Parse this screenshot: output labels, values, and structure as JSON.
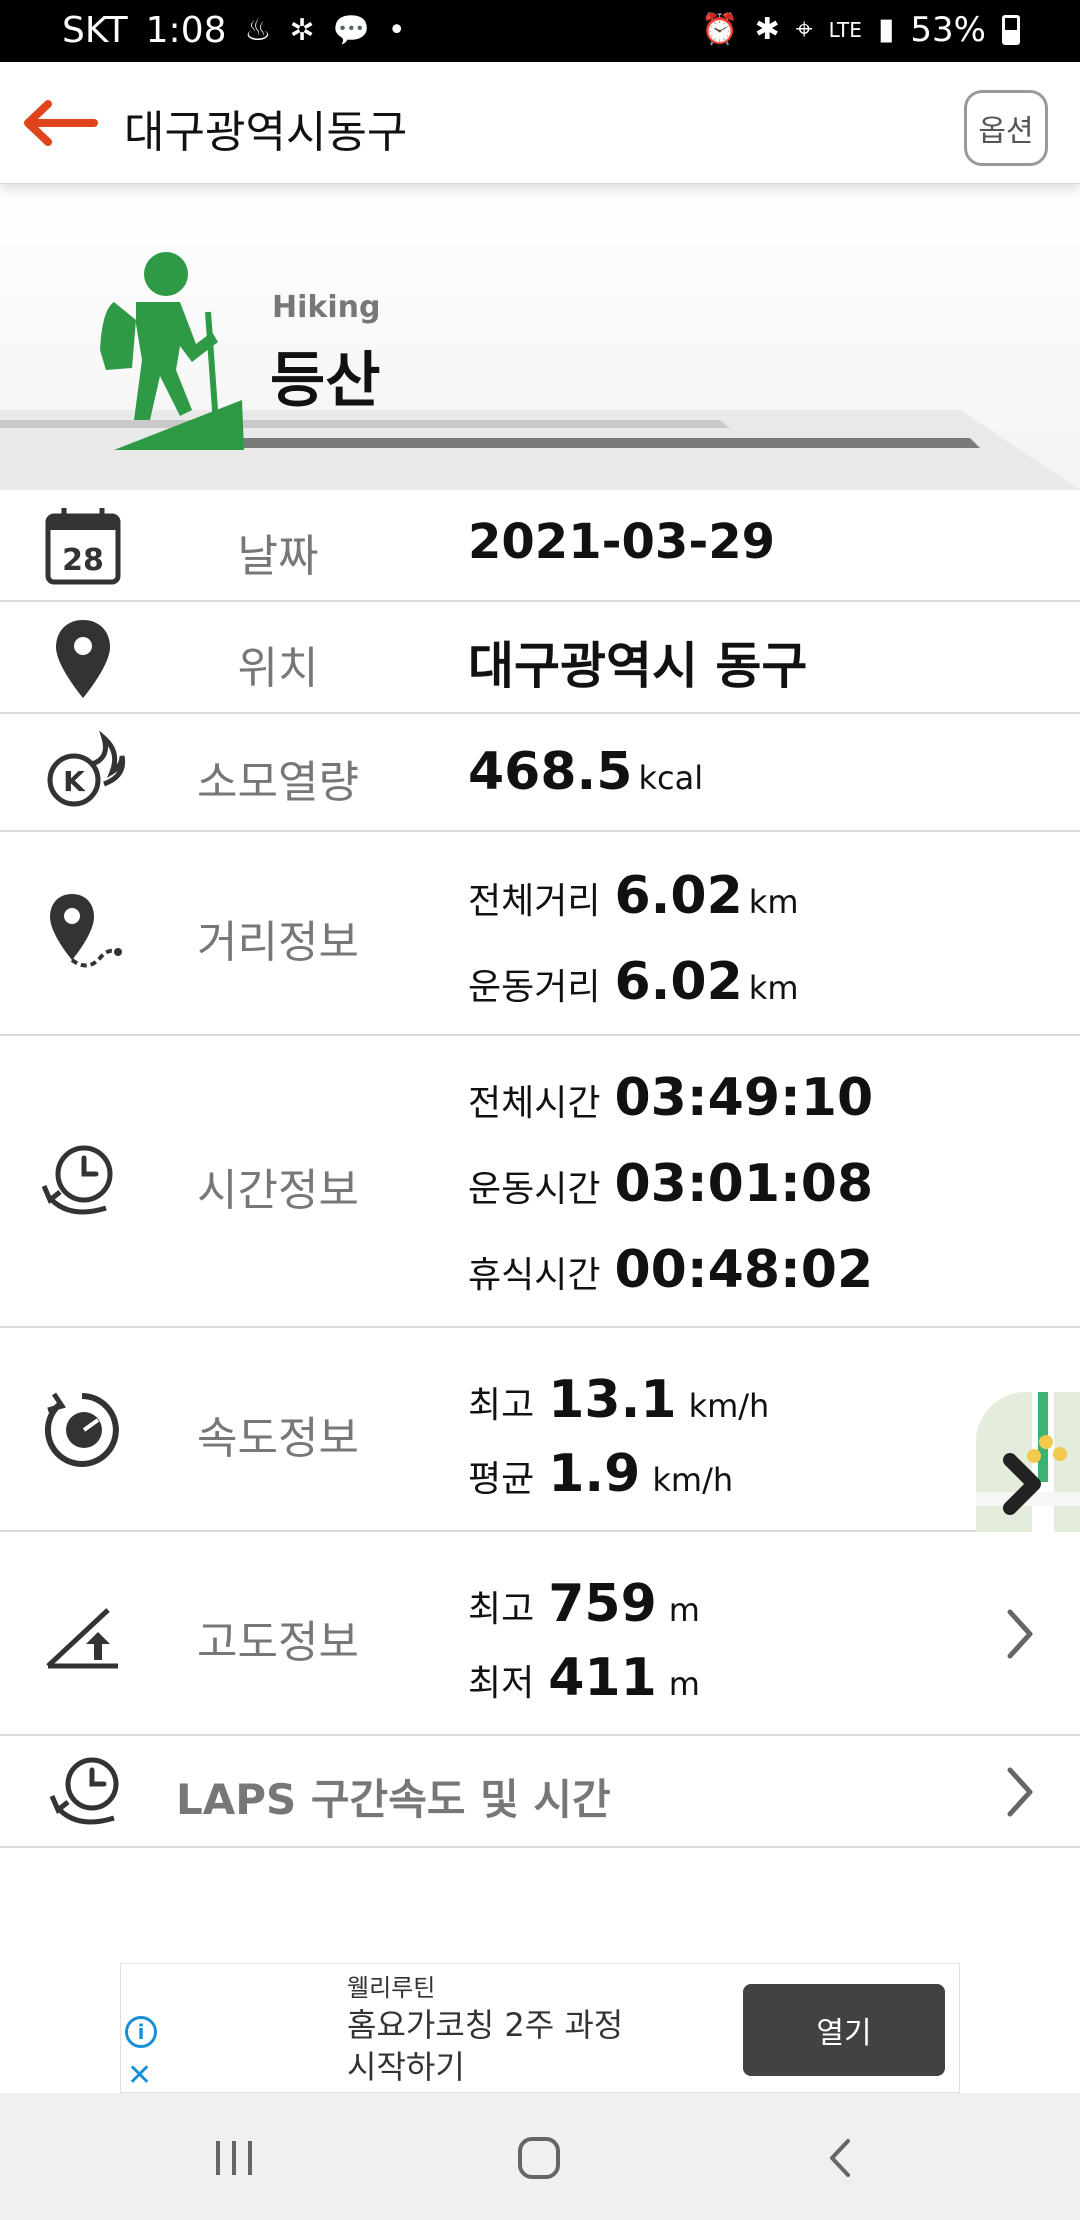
{
  "status_bar": {
    "carrier": "SKT",
    "time": "1:08",
    "network": "LTE",
    "battery": "53%"
  },
  "header": {
    "title": "대구광역시동구",
    "option_label": "옵션"
  },
  "activity": {
    "type_en": "Hiking",
    "type_ko": "등산"
  },
  "rows": {
    "date": {
      "label": "날짜",
      "value": "2021-03-29",
      "calendar_day": "28"
    },
    "location": {
      "label": "위치",
      "value": "대구광역시 동구"
    },
    "calories": {
      "label": "소모열량",
      "value": "468.5",
      "unit": "kcal"
    },
    "distance": {
      "label": "거리정보",
      "total_label": "전체거리",
      "total_value": "6.02",
      "total_unit": "km",
      "exercise_label": "운동거리",
      "exercise_value": "6.02",
      "exercise_unit": "km"
    },
    "time": {
      "label": "시간정보",
      "total_label": "전체시간",
      "total_value": "03:49:10",
      "exercise_label": "운동시간",
      "exercise_value": "03:01:08",
      "rest_label": "휴식시간",
      "rest_value": "00:48:02"
    },
    "speed": {
      "label": "속도정보",
      "max_label": "최고",
      "max_value": "13.1",
      "max_unit": "km/h",
      "avg_label": "평균",
      "avg_value": "1.9",
      "avg_unit": "km/h"
    },
    "altitude": {
      "label": "고도정보",
      "max_label": "최고",
      "max_value": "759",
      "max_unit": "m",
      "min_label": "최저",
      "min_value": "411",
      "min_unit": "m"
    },
    "laps": {
      "label": "LAPS 구간속도 및 시간"
    }
  },
  "ad": {
    "brand": "웰리루틴",
    "text_line1": "홈요가코칭 2주 과정",
    "text_line2": "시작하기",
    "button": "열기"
  },
  "colors": {
    "accent_orange": "#e0441a",
    "hiker_green": "#2e9a45",
    "label_gray": "#777777"
  }
}
